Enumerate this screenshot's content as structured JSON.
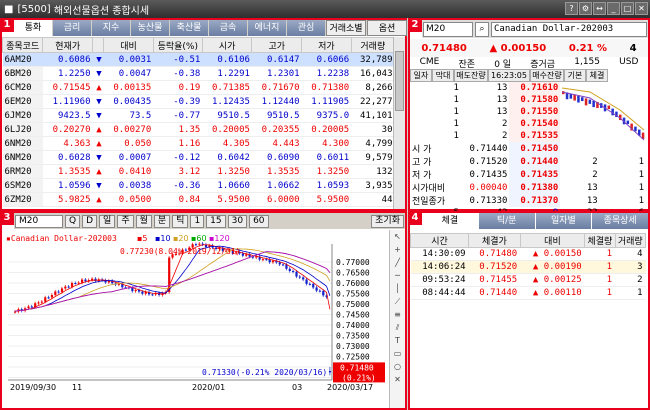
{
  "window": {
    "number": "[5500]",
    "title": "해외선물옵션 종합시세"
  },
  "titlebar_icons": [
    "help-icon",
    "settings-icon",
    "min-icon",
    "max-icon",
    "close-icon"
  ],
  "p1": {
    "tabs": [
      "통화",
      "금리",
      "지수",
      "농산물",
      "축산물",
      "금속",
      "에너지",
      "관심",
      "거래소별",
      "옵션"
    ],
    "headers": [
      "종목코드",
      "현재가",
      "",
      "대비",
      "등락율(%)",
      "시가",
      "고가",
      "저가",
      "거래량"
    ],
    "rows": [
      {
        "code": "6AM20",
        "price": "0.6086",
        "dir": "▼",
        "chg": "0.0031",
        "rate": "-0.51",
        "open": "0.6106",
        "high": "0.6147",
        "low": "0.6066",
        "vol": "32,789",
        "c": "dn"
      },
      {
        "code": "6BM20",
        "price": "1.2250",
        "dir": "▼",
        "chg": "0.0047",
        "rate": "-0.38",
        "open": "1.2291",
        "high": "1.2301",
        "low": "1.2238",
        "vol": "16,043",
        "c": "dn"
      },
      {
        "code": "6CM20",
        "price": "0.71545",
        "dir": "▲",
        "chg": "0.00135",
        "rate": "0.19",
        "open": "0.71385",
        "high": "0.71670",
        "low": "0.71380",
        "vol": "8,266",
        "c": "up"
      },
      {
        "code": "6EM20",
        "price": "1.11960",
        "dir": "▼",
        "chg": "0.00435",
        "rate": "-0.39",
        "open": "1.12435",
        "high": "1.12440",
        "low": "1.11905",
        "vol": "22,277",
        "c": "dn"
      },
      {
        "code": "6JM20",
        "price": "9423.5",
        "dir": "▼",
        "chg": "73.5",
        "rate": "-0.77",
        "open": "9510.5",
        "high": "9510.5",
        "low": "9375.0",
        "vol": "41,101",
        "c": "dn"
      },
      {
        "code": "6LJ20",
        "price": "0.20270",
        "dir": "▲",
        "chg": "0.00270",
        "rate": "1.35",
        "open": "0.20005",
        "high": "0.20355",
        "low": "0.20005",
        "vol": "30",
        "c": "up"
      },
      {
        "code": "6NM20",
        "price": "4.363",
        "dir": "▲",
        "chg": "0.050",
        "rate": "1.16",
        "open": "4.305",
        "high": "4.443",
        "low": "4.300",
        "vol": "4,799",
        "c": "up"
      },
      {
        "code": "6NM20",
        "price": "0.6028",
        "dir": "▼",
        "chg": "0.0007",
        "rate": "-0.12",
        "open": "0.6042",
        "high": "0.6090",
        "low": "0.6011",
        "vol": "9,579",
        "c": "dn"
      },
      {
        "code": "6RM20",
        "price": "1.3535",
        "dir": "▲",
        "chg": "0.0410",
        "rate": "3.12",
        "open": "1.3250",
        "high": "1.3535",
        "low": "1.3250",
        "vol": "132",
        "c": "up"
      },
      {
        "code": "6SM20",
        "price": "1.0596",
        "dir": "▼",
        "chg": "0.0038",
        "rate": "-0.36",
        "open": "1.0660",
        "high": "1.0662",
        "low": "1.0593",
        "vol": "3,935",
        "c": "dn"
      },
      {
        "code": "6ZM20",
        "price": "5.9825",
        "dir": "▲",
        "chg": "0.0500",
        "rate": "0.84",
        "open": "5.9500",
        "high": "6.0000",
        "low": "5.9500",
        "vol": "44",
        "c": "up"
      }
    ]
  },
  "p2": {
    "code": "M20",
    "name": "Canadian Dollar-202003",
    "price": "0.71480",
    "dir": "▲",
    "chg": "0.00150",
    "rate": "0.21",
    "unit": "%",
    "qty": "4",
    "info": [
      "CME",
      "잔존",
      "0 일",
      "증거금",
      "1,155",
      "USD"
    ],
    "hdr": [
      "일자",
      "막대",
      "매도잔량",
      "16:23:05",
      "매수잔량",
      "기본",
      "체결"
    ],
    "asks": [
      {
        "q": "1",
        "s": "13",
        "p": "0.71610"
      },
      {
        "q": "1",
        "s": "13",
        "p": "0.71580"
      },
      {
        "q": "1",
        "s": "13",
        "p": "0.71550"
      },
      {
        "q": "1",
        "s": "2",
        "p": "0.71540"
      },
      {
        "q": "1",
        "s": "2",
        "p": "0.71535"
      }
    ],
    "stats": [
      {
        "l": "시  가",
        "v": "0.71440",
        "p": "0.71450",
        "b": "3",
        "b2": "2"
      },
      {
        "l": "고  가",
        "v": "0.71520",
        "p": "0.71440",
        "b": "2",
        "b2": "1"
      },
      {
        "l": "저  가",
        "v": "0.71435",
        "p": "0.71435",
        "b": "2",
        "b2": "1"
      },
      {
        "l": "시가대비",
        "v": "0.00040",
        "p": "0.71380",
        "b": "13",
        "b2": "1"
      },
      {
        "l": "전일종가",
        "v": "0.71330",
        "p": "0.71370",
        "b": "13",
        "b2": "1"
      }
    ],
    "foot": [
      "5",
      "42",
      "-9",
      "33",
      "6"
    ]
  },
  "p3": {
    "code": "M20",
    "buttons": [
      "Q",
      "D",
      "일",
      "주",
      "월",
      "분",
      "틱",
      "1",
      "15",
      "30",
      "60"
    ],
    "init": "초기화",
    "legend": "Canadian Dollar-202003",
    "ma": [
      "5",
      "10",
      "20",
      "60",
      "120"
    ],
    "high_label": "0.77230(8.04% 2019/12/31)",
    "low_label": "0.71330(-0.21% 2020/03/16)",
    "price_now": "0.71480",
    "price_pct": "0.21%",
    "xlabels": [
      "2019/09/30",
      "11",
      "2020/01",
      "03",
      "2020/03/17"
    ],
    "ylabels": [
      "0.77000",
      "0.76500",
      "0.76000",
      "0.75500",
      "0.75000",
      "0.74500",
      "0.74000",
      "0.73500",
      "0.73000",
      "0.72500",
      "0.72000",
      "0.71500"
    ]
  },
  "p4": {
    "tabs": [
      "체결",
      "틱/분",
      "일자별",
      "종목상세"
    ],
    "headers": [
      "시간",
      "체결가",
      "대비",
      "체결량",
      "거래량"
    ],
    "rows": [
      {
        "t": "14:30:09",
        "p": "0.71480",
        "d": "▲",
        "c": "0.00150",
        "q": "1",
        "v": "4"
      },
      {
        "t": "14:06:24",
        "p": "0.71520",
        "d": "▲",
        "c": "0.00190",
        "q": "1",
        "v": "3"
      },
      {
        "t": "09:53:24",
        "p": "0.71455",
        "d": "▲",
        "c": "0.00125",
        "q": "1",
        "v": "2"
      },
      {
        "t": "08:44:44",
        "p": "0.71440",
        "d": "▲",
        "c": "0.00110",
        "q": "1",
        "v": "1"
      }
    ]
  }
}
